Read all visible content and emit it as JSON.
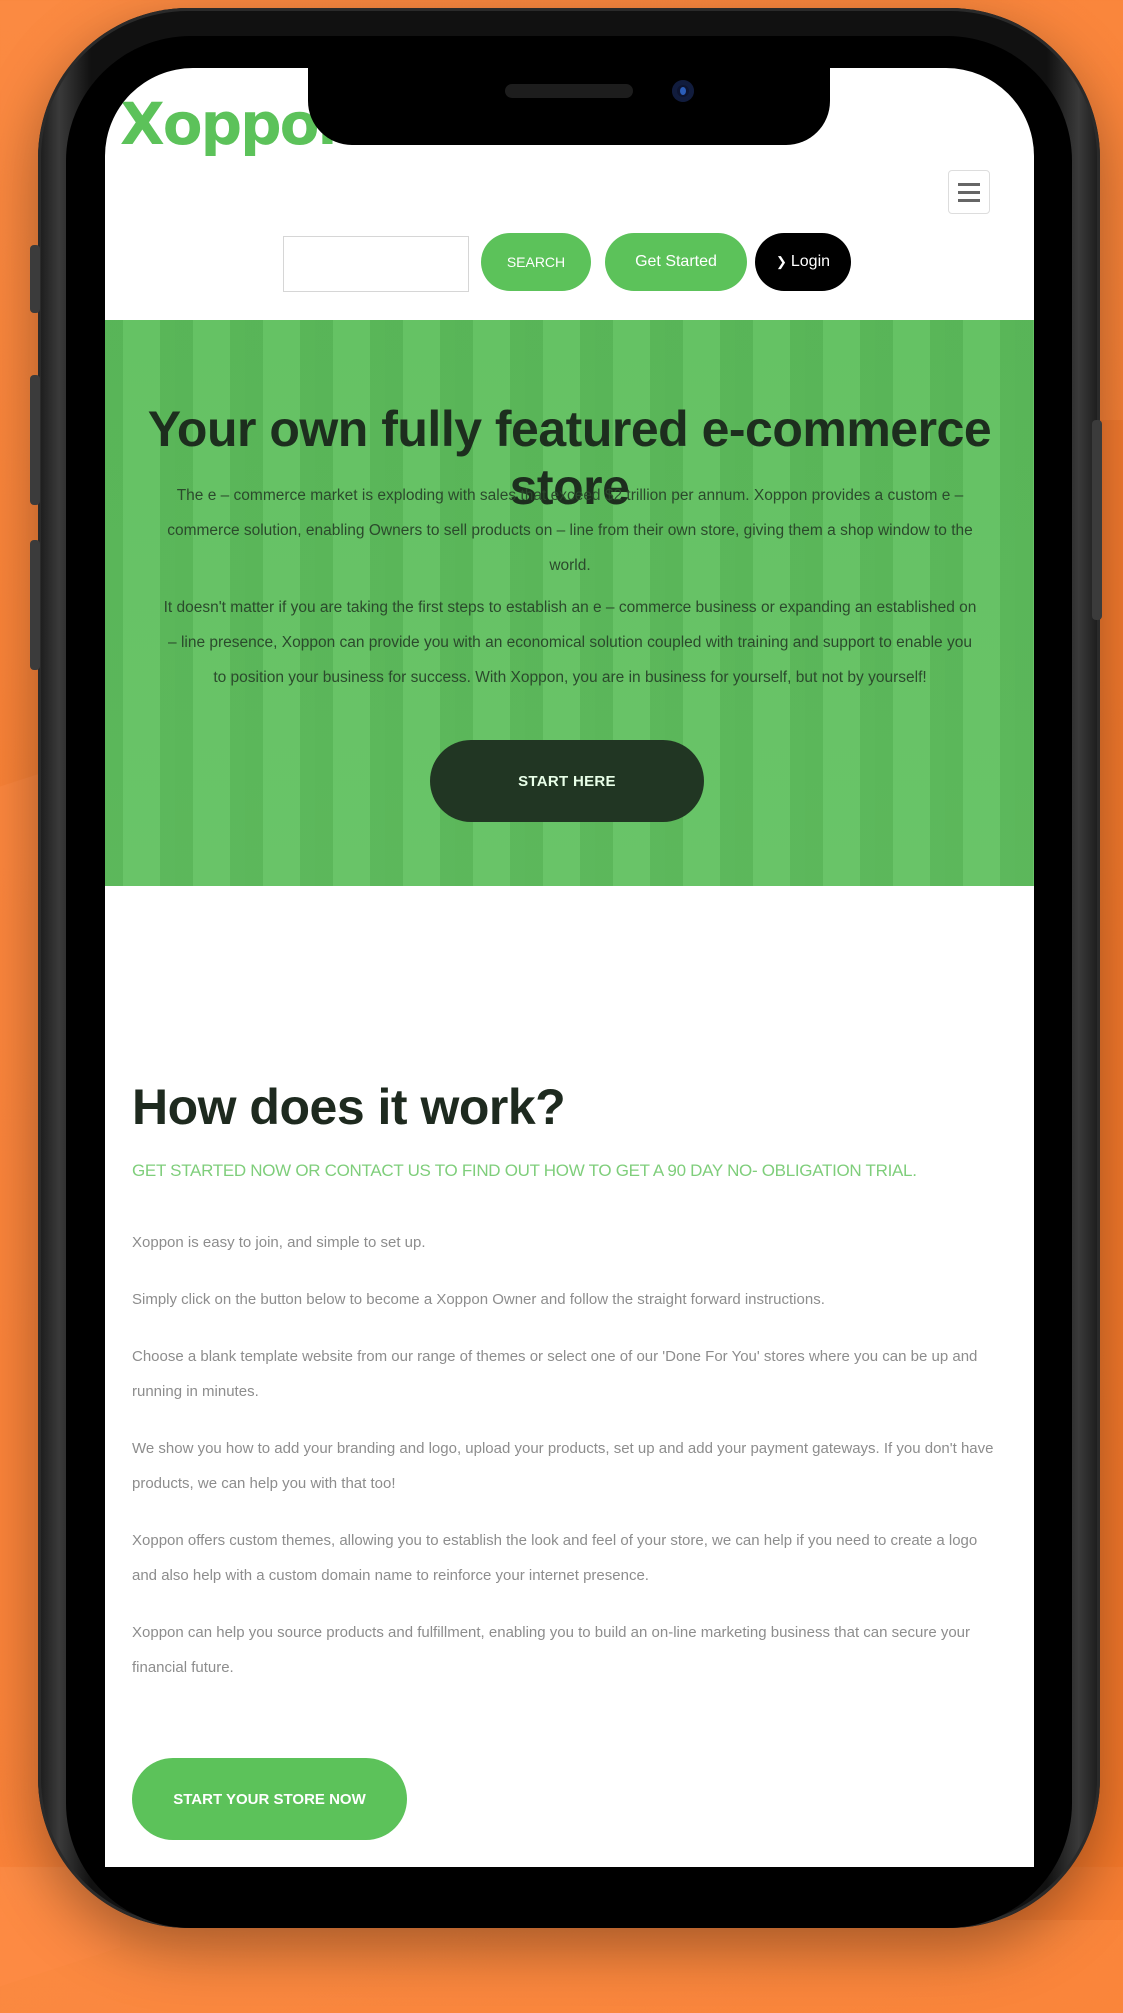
{
  "site": {
    "logo": "Xoppon"
  },
  "header": {
    "search_placeholder": "",
    "search_button": "SEARCH",
    "get_started_button": "Get Started",
    "login_button": "Login"
  },
  "hero": {
    "title": "Your own fully featured e-commerce store",
    "paragraph_1": "The e – commerce market is exploding with sales that exceed $2 trillion per annum. Xoppon provides a custom e – commerce solution, enabling Owners to sell products on – line from their own store, giving them a shop window to the world.",
    "paragraph_2": "It doesn't matter if you are taking the first steps to establish an e – commerce business or expanding an established on – line presence, Xoppon can provide you with an economical solution coupled with training and support to enable you to position your business for success. With Xoppon, you are in business for yourself, but not by yourself!",
    "cta_button": "START HERE"
  },
  "how": {
    "title": "How does it work?",
    "subtitle": "GET STARTED NOW OR CONTACT US TO FIND OUT HOW TO GET A 90 DAY NO- OBLIGATION TRIAL.",
    "items": [
      "Xoppon is easy to join, and simple to set up.",
      "Simply click on the button below to become a Xoppon Owner and follow the straight forward instructions.",
      "Choose a blank template website from our range of themes or select one of our 'Done For You' stores where you can be up and running in minutes.",
      "We show you how to add your branding and logo, upload your products, set up and add your payment gateways. If you don't have products, we can help you with that too!",
      "Xoppon offers custom themes, allowing you to establish the look and feel of your store, we can help if you need to create a logo and also help with a custom domain name to reinforce your internet presence.",
      "Xoppon can help you source products and fulfillment, enabling you to build an on-line marketing business that can secure your financial future."
    ],
    "cta_button": "START YOUR STORE NOW"
  },
  "colors": {
    "background_orange": "#f97d2f",
    "brand_green": "#5cc25a",
    "dark_green": "#213623",
    "login_black": "#000000"
  },
  "icons": {
    "login": "sign-in-icon",
    "menu": "hamburger-menu-icon"
  }
}
